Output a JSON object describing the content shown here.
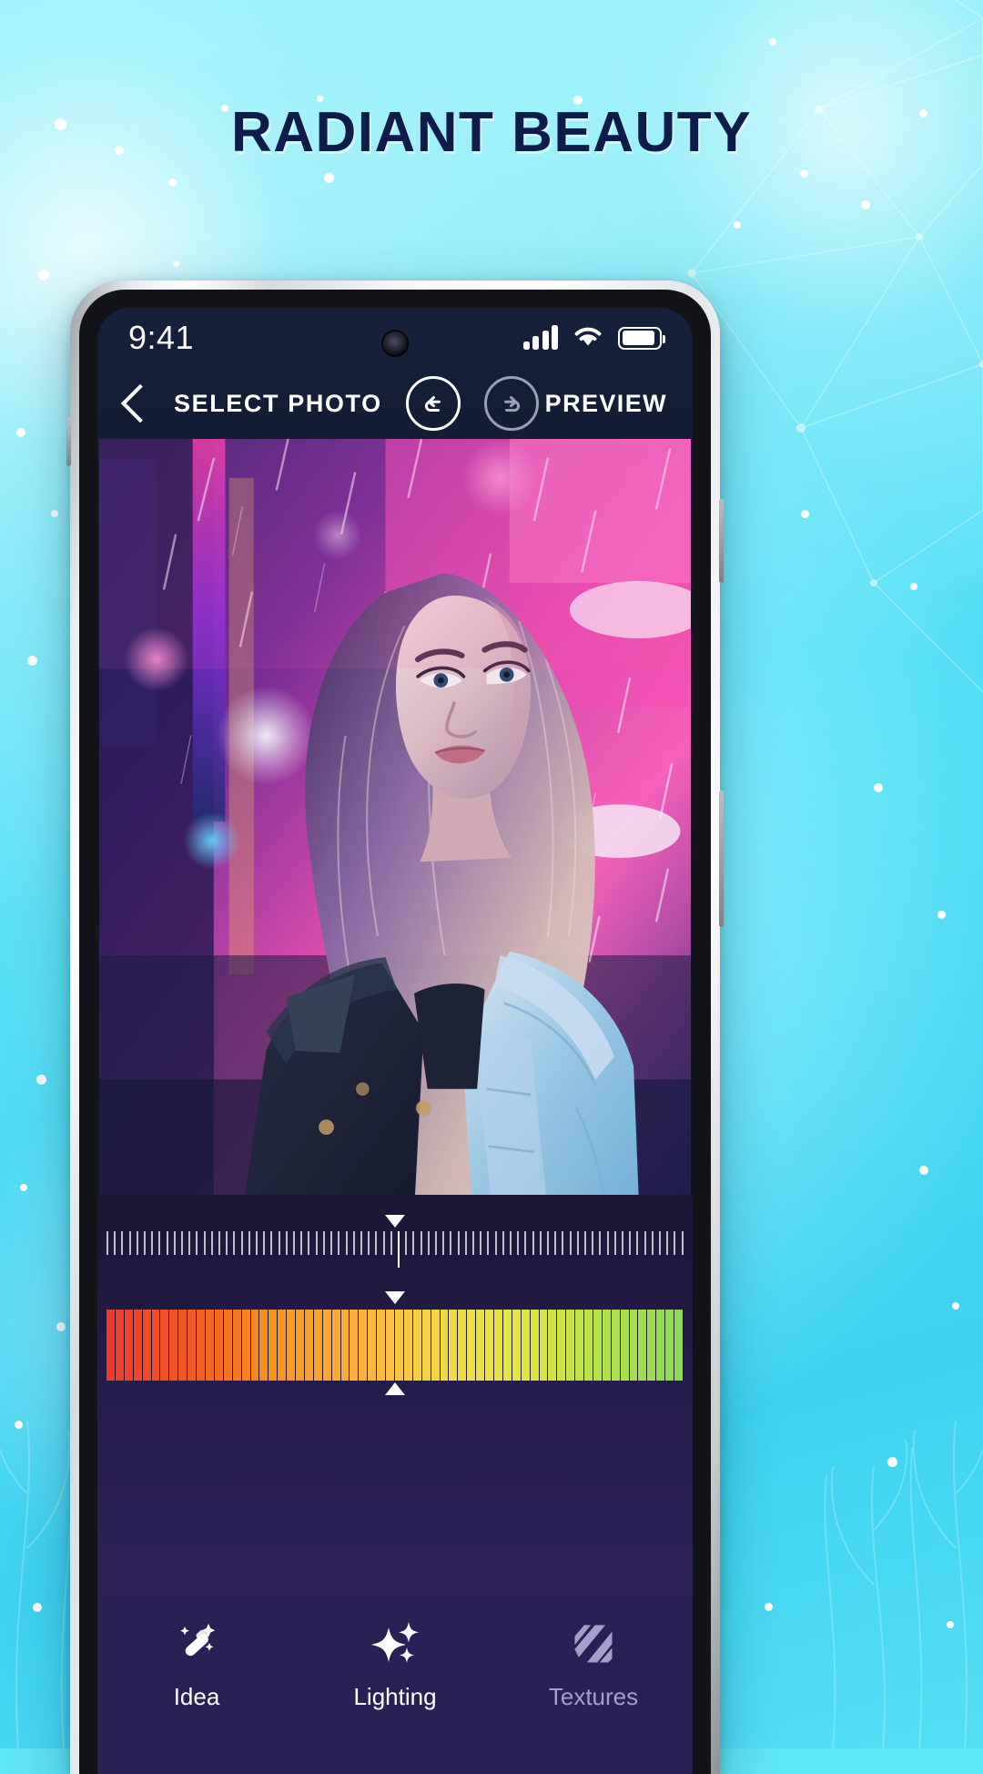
{
  "headline": "RADIANT BEAUTY",
  "theme": {
    "bg_cyan": "#49dcf4",
    "headline_navy": "#0d1c4a",
    "app_dark": "#0e1526",
    "app_purple": "#2b2056",
    "accent_white": "#ffffff",
    "muted_purple": "#a79ec7"
  },
  "phone": {
    "statusbar": {
      "time": "9:41",
      "icons": [
        "signal-bars-icon",
        "wifi-icon",
        "battery-icon"
      ],
      "battery_level": "92"
    },
    "navbar": {
      "back_icon": "chevron-left-icon",
      "title": "SELECT PHOTO",
      "undo_label": "Undo",
      "undo_icon": "undo-circle-icon",
      "redo_label": "Redo",
      "redo_icon": "redo-circle-icon",
      "preview_label": "PREVIEW"
    },
    "canvas": {
      "alt": "Portrait of a woman looking upward on a neon-lit rainy city street"
    },
    "controls": {
      "ruler": {
        "tick_count": 78,
        "value_percent": 50,
        "knob_top_icon": "slider-knob-down",
        "knob_bottom_icon": "slider-knob-up"
      },
      "gradient": {
        "stripe_count": 64,
        "value_percent": 50,
        "knob_top_icon": "slider-knob-down",
        "knob_bottom_icon": "slider-knob-up",
        "stops": [
          "#ef3b2c",
          "#f05a24",
          "#f7941e",
          "#fbb03b",
          "#f3d544",
          "#e4e63f",
          "#b7e04a",
          "#8ddb52"
        ]
      }
    },
    "tabs": [
      {
        "label": "Idea",
        "icon": "magic-wand-icon",
        "active": true
      },
      {
        "label": "Lighting",
        "icon": "sparkles-icon",
        "active": true
      },
      {
        "label": "Textures",
        "icon": "texture-stripes-icon",
        "active": false
      }
    ]
  }
}
